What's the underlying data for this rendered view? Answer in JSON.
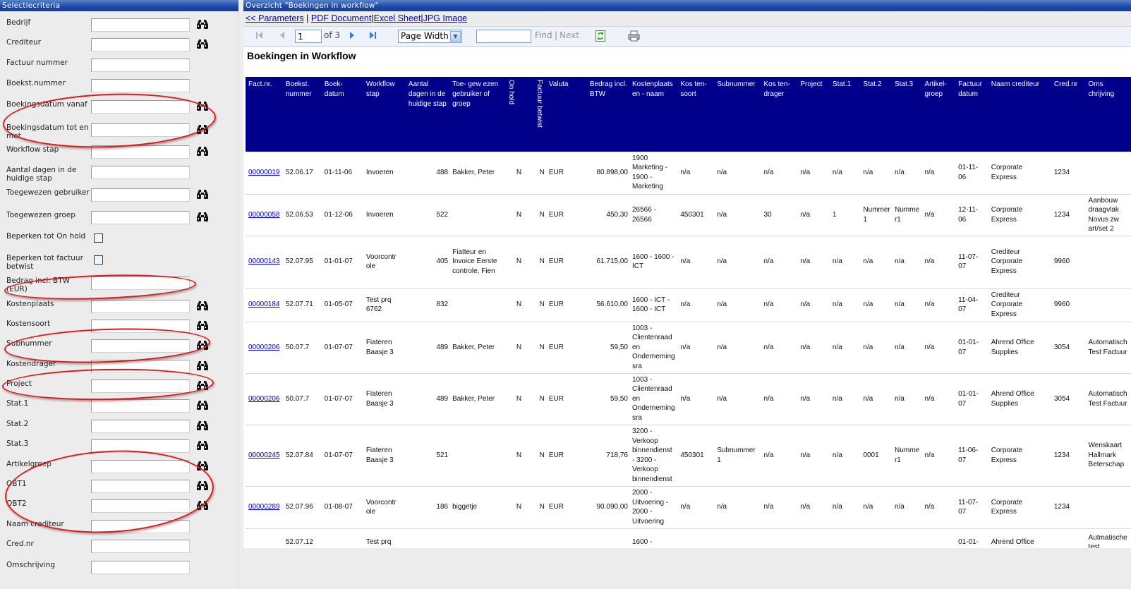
{
  "left_panel": {
    "title": "Selectiecriteria",
    "criteria": [
      {
        "label": "Bedrijf",
        "type": "text",
        "value": "",
        "lookup": true
      },
      {
        "label": "Crediteur",
        "type": "text",
        "value": "",
        "lookup": true
      },
      {
        "label": "Factuur nummer",
        "type": "text",
        "value": "",
        "lookup": false
      },
      {
        "label": "Boekst.nummer",
        "type": "text",
        "value": "",
        "lookup": false
      },
      {
        "label": "Boekingsdatum vanaf",
        "type": "text",
        "value": "",
        "lookup": true
      },
      {
        "label": "Boekingsdatum tot en met",
        "type": "text",
        "value": "",
        "lookup": true
      },
      {
        "label": "Workflow stap",
        "type": "text",
        "value": "",
        "lookup": true
      },
      {
        "label": "Aantal dagen in de huidige stap",
        "type": "text",
        "value": "",
        "lookup": false
      },
      {
        "label": "Toegewezen gebruiker",
        "type": "text",
        "value": "",
        "lookup": true
      },
      {
        "label": "Toegewezen groep",
        "type": "text",
        "value": "",
        "lookup": true
      },
      {
        "label": "Beperken tot On hold",
        "type": "checkbox",
        "checked": false,
        "lookup": false
      },
      {
        "label": "Beperken tot factuur betwist",
        "type": "checkbox",
        "checked": false,
        "lookup": false
      },
      {
        "label": "Bedrag incl. BTW (EUR)",
        "type": "text",
        "value": "",
        "lookup": false
      },
      {
        "label": "Kostenplaats",
        "type": "text",
        "value": "",
        "lookup": true
      },
      {
        "label": "Kostensoort",
        "type": "text",
        "value": "",
        "lookup": true
      },
      {
        "label": "Subnummer",
        "type": "text",
        "value": "",
        "lookup": true
      },
      {
        "label": "Kostendrager",
        "type": "text",
        "value": "",
        "lookup": true
      },
      {
        "label": "Project",
        "type": "text",
        "value": "",
        "lookup": true
      },
      {
        "label": "Stat.1",
        "type": "text",
        "value": "",
        "lookup": true
      },
      {
        "label": "Stat.2",
        "type": "text",
        "value": "",
        "lookup": true
      },
      {
        "label": "Stat.3",
        "type": "text",
        "value": "",
        "lookup": true
      },
      {
        "label": "Artikelgroep",
        "type": "text",
        "value": "",
        "lookup": true
      },
      {
        "label": "OBT1",
        "type": "text",
        "value": "",
        "lookup": true
      },
      {
        "label": "OBT2",
        "type": "text",
        "value": "",
        "lookup": true
      },
      {
        "label": "Naam crediteur",
        "type": "text",
        "value": "",
        "lookup": false
      },
      {
        "label": "Cred.nr",
        "type": "text",
        "value": "",
        "lookup": false
      },
      {
        "label": "Omschrijving",
        "type": "text",
        "value": "",
        "lookup": false
      }
    ],
    "lookup_icon": "binoculars-icon",
    "annotation_color": "#e01818"
  },
  "right_panel": {
    "title": "Overzicht \"Boekingen in workflow\"",
    "export_links": {
      "parameters": "<< Parameters",
      "pdf": "PDF Document",
      "excel": "Excel Sheet",
      "jpg": "JPG Image",
      "separator": "|"
    },
    "toolbar": {
      "first_icon": "first-page-icon",
      "prev_icon": "previous-page-icon",
      "page_value": "1",
      "page_of": "of 3",
      "next_icon": "next-page-icon",
      "last_icon": "last-page-icon",
      "zoom_value": "Page Width",
      "find_value": "",
      "find_label": "Find",
      "find_sep": "|",
      "next_label": "Next",
      "refresh_icon": "refresh-icon",
      "print_icon": "print-icon"
    },
    "report": {
      "title": "Boekingen in Workflow",
      "header_color": "#00008b",
      "columns": [
        "Fact.nr.",
        "Boekst. nummer",
        "Boek- datum",
        "Workflow stap",
        "Aantal dagen in de huidige stap",
        "Toe- gew ezen gebruiker of groep",
        "On hold",
        "Factuur betwist",
        "Valuta",
        "Bedrag incl. BTW",
        "Kostenplaats en - naam",
        "Kos ten- soort",
        "Subnummer",
        "Kos ten- drager",
        "Project",
        "Stat.1",
        "Stat.2",
        "Stat.3",
        "Artikel- groep",
        "Factuur datum",
        "Naam crediteur",
        "Cred.nr",
        "Oms chrijving"
      ],
      "rows": [
        [
          "00000019",
          "52.06.17",
          "01-11-06",
          "Invoeren",
          "488",
          "Bakker, Peter",
          "N",
          "N",
          "EUR",
          "80.898,00",
          "1900 Marketing - 1900 - Marketing",
          "n/a",
          "n/a",
          "n/a",
          "n/a",
          "n/a",
          "n/a",
          "n/a",
          "n/a",
          "01-11- 06",
          "Corporate Express",
          "1234",
          ""
        ],
        [
          "00000058",
          "52.06.53",
          "01-12-06",
          "Invoeren",
          "522",
          "",
          "N",
          "N",
          "EUR",
          "450,30",
          "26566 - 26566",
          "450301",
          "n/a",
          "30",
          "n/a",
          "1",
          "Nummer 1",
          "Numme r1",
          "n/a",
          "12-11- 06",
          "Corporate Express",
          "1234",
          "Aanbouw draagvlak Novus zw art/set 2"
        ],
        [
          "00000143",
          "52.07.95",
          "01-01-07",
          "Voorcontr ole",
          "405",
          "Fiatteur en Invoice Eerste controle, Fien",
          "N",
          "N",
          "EUR",
          "61.715,00",
          "1600 - 1600 - ICT",
          "n/a",
          "n/a",
          "n/a",
          "n/a",
          "n/a",
          "n/a",
          "n/a",
          "n/a",
          "11-07- 07",
          "Crediteur Corporate Express",
          "9960",
          ""
        ],
        [
          "00000184",
          "52.07.71",
          "01-05-07",
          "Test prq 6762",
          "832",
          "",
          "N",
          "N",
          "EUR",
          "56.610,00",
          "1600 - ICT - 1600 - ICT",
          "n/a",
          "n/a",
          "n/a",
          "n/a",
          "n/a",
          "n/a",
          "n/a",
          "n/a",
          "11-04- 07",
          "Crediteur Corporate Express",
          "9960",
          ""
        ],
        [
          "00000206",
          "50.07.7",
          "01-07-07",
          "Fiateren Baasje 3",
          "489",
          "Bakker, Peter",
          "N",
          "N",
          "EUR",
          "59,50",
          "1003 - Clientenraad en Onderneming sra",
          "n/a",
          "n/a",
          "n/a",
          "n/a",
          "n/a",
          "n/a",
          "n/a",
          "n/a",
          "01-01- 07",
          "Ahrend Office Supplies",
          "3054",
          "Automatisch Test Factuur"
        ],
        [
          "00000206",
          "50.07.7",
          "01-07-07",
          "Fiateren Baasje 3",
          "489",
          "Bakker, Peter",
          "N",
          "N",
          "EUR",
          "59,50",
          "1003 - Clientenraad en Onderneming sra",
          "n/a",
          "n/a",
          "n/a",
          "n/a",
          "n/a",
          "n/a",
          "n/a",
          "n/a",
          "01-01- 07",
          "Ahrend Office Supplies",
          "3054",
          "Automatisch Test Factuur"
        ],
        [
          "00000245",
          "52.07.84",
          "01-07-07",
          "Fiateren Baasje 3",
          "521",
          "",
          "N",
          "N",
          "EUR",
          "718,76",
          "3200 - Verkoop binnendienst - 3200 - Verkoop binnendienst",
          "450301",
          "Subnummer 1",
          "n/a",
          "n/a",
          "n/a",
          "0001",
          "Numme r1",
          "n/a",
          "11-06- 07",
          "Corporate Express",
          "1234",
          "Wenskaart Hallmark Beterschap"
        ],
        [
          "00000289",
          "52.07.96",
          "01-08-07",
          "Voorcontr ole",
          "186",
          "biggetje",
          "N",
          "N",
          "EUR",
          "90.090,00",
          "2000 - Uitvoering - 2000 - Uitvoering",
          "n/a",
          "n/a",
          "n/a",
          "n/a",
          "n/a",
          "n/a",
          "n/a",
          "n/a",
          "11-07- 07",
          "Corporate Express",
          "1234",
          ""
        ],
        [
          "",
          "52.07.12",
          "",
          "Test prq",
          "",
          "",
          "",
          "",
          "",
          "",
          "1600 -",
          "",
          "",
          "",
          "",
          "",
          "",
          "",
          "",
          "01-01-",
          "Ahrend Office",
          "",
          "Autmatische test"
        ]
      ]
    }
  }
}
